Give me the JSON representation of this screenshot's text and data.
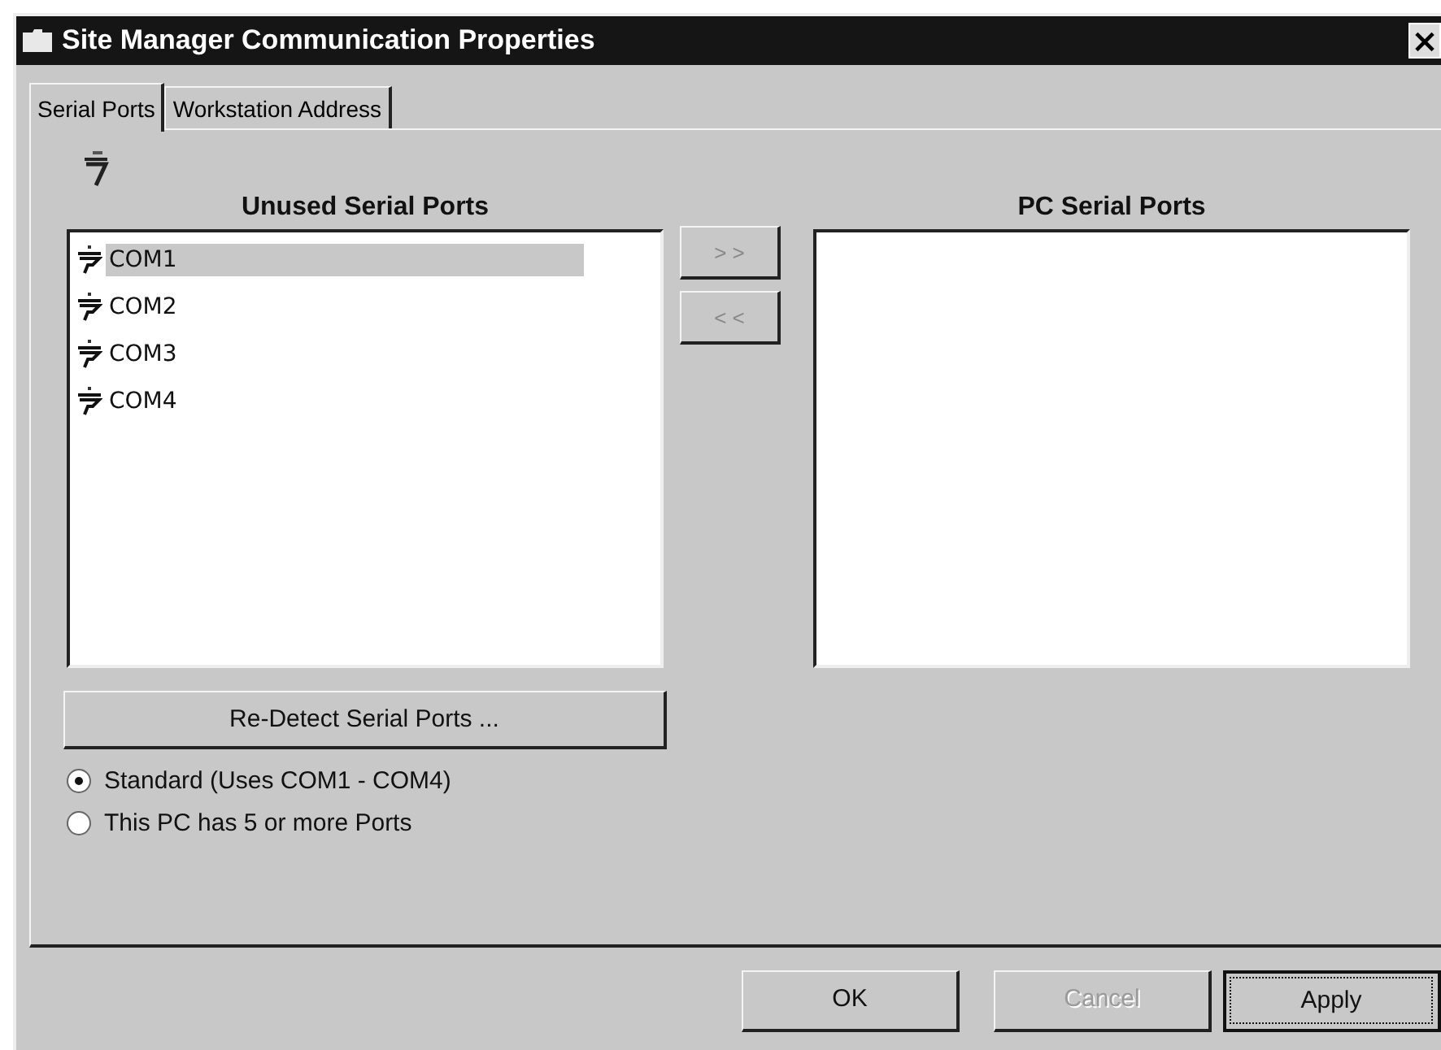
{
  "window": {
    "title": "Site Manager Communication Properties",
    "close": "×"
  },
  "tabs": [
    {
      "label": "Serial Ports",
      "selected": true
    },
    {
      "label": "Workstation Address",
      "selected": false
    }
  ],
  "unused_ports": {
    "heading": "Unused Serial Ports",
    "items": [
      {
        "label": "COM1",
        "selected": true
      },
      {
        "label": "COM2",
        "selected": false
      },
      {
        "label": "COM3",
        "selected": false
      },
      {
        "label": "COM4",
        "selected": false
      }
    ]
  },
  "move_buttons": [
    {
      "label": "> >"
    },
    {
      "label": "< <"
    }
  ],
  "pc_ports": {
    "heading": "PC Serial Ports"
  },
  "redetect_button": "Re-Detect Serial Ports ...",
  "options": [
    {
      "label": "Standard (Uses COM1 - COM4)",
      "selected": true
    },
    {
      "label": "This PC has 5 or more Ports",
      "selected": false
    }
  ],
  "buttons": [
    {
      "label": "OK",
      "disabled": false,
      "focused": false
    },
    {
      "label": "Cancel",
      "disabled": true,
      "focused": false
    },
    {
      "label": "Apply",
      "disabled": false,
      "focused": true
    }
  ]
}
